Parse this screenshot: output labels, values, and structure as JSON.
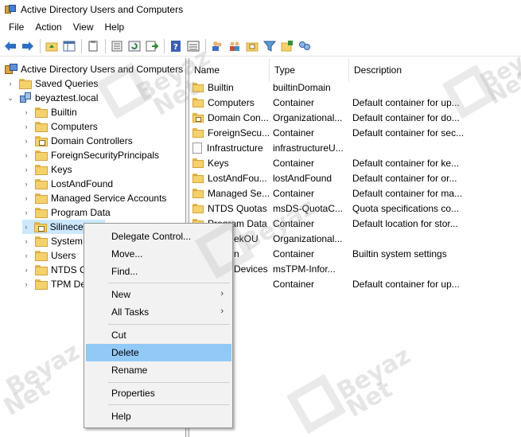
{
  "window": {
    "title": "Active Directory Users and Computers"
  },
  "menu": [
    "File",
    "Action",
    "View",
    "Help"
  ],
  "toolbar": {
    "icons": [
      "back-icon",
      "forward-icon",
      "up-folder-icon",
      "show-console-tree-icon",
      "clipboard-icon",
      "properties-icon",
      "refresh-icon",
      "export-list-icon",
      "help-icon",
      "details-view-icon",
      "users-icon",
      "groups-icon",
      "new-ou-icon",
      "filter-icon",
      "delegate-icon",
      "find-icon"
    ]
  },
  "tree": {
    "root_label": "Active Directory Users and Computers",
    "saved_queries": "Saved Queries",
    "domain": "beyaztest.local",
    "children": [
      "Builtin",
      "Computers",
      "Domain Controllers",
      "ForeignSecurityPrincipals",
      "Keys",
      "LostAndFound",
      "Managed Service Accounts",
      "Program Data",
      "SilinecekOU",
      "System",
      "Users",
      "NTDS Quotas",
      "TPM Devices"
    ],
    "children_visible": [
      "Builtin",
      "Computers",
      "Domain Controllers",
      "ForeignSecurityPrincipals",
      "Keys",
      "LostAndFound",
      "Managed Service Accounts",
      "Program Data",
      "Silinecek OU",
      "System",
      "Users",
      "NTDS C",
      "TPM De"
    ]
  },
  "list": {
    "columns": [
      "Name",
      "Type",
      "Description"
    ],
    "rows": [
      {
        "name": "Builtin",
        "type": "builtinDomain",
        "description": "",
        "icon": "folder"
      },
      {
        "name": "Computers",
        "type": "Container",
        "description": "Default container for up...",
        "icon": "folder"
      },
      {
        "name": "Domain Con...",
        "type": "Organizational...",
        "description": "Default container for do...",
        "icon": "ou"
      },
      {
        "name": "ForeignSecu...",
        "type": "Container",
        "description": "Default container for sec...",
        "icon": "folder"
      },
      {
        "name": "Infrastructure",
        "type": "infrastructureU...",
        "description": "",
        "icon": "doc"
      },
      {
        "name": "Keys",
        "type": "Container",
        "description": "Default container for ke...",
        "icon": "folder"
      },
      {
        "name": "LostAndFou...",
        "type": "lostAndFound",
        "description": "Default container for or...",
        "icon": "folder"
      },
      {
        "name": "Managed Se...",
        "type": "Container",
        "description": "Default container for ma...",
        "icon": "folder"
      },
      {
        "name": "NTDS Quotas",
        "type": "msDS-QuotaC...",
        "description": "Quota specifications co...",
        "icon": "folder"
      },
      {
        "name": "Program Data",
        "type": "Container",
        "description": "Default location for stor...",
        "icon": "folder"
      },
      {
        "name": "ekOU",
        "type": "Organizational...",
        "description": "",
        "icon": "none"
      },
      {
        "name": "n",
        "type": "Container",
        "description": "Builtin system settings",
        "icon": "none"
      },
      {
        "name": "Devices",
        "type": "msTPM-Infor...",
        "description": "",
        "icon": "none"
      },
      {
        "name": "",
        "type": "Container",
        "description": "Default container for up...",
        "icon": "none"
      }
    ]
  },
  "context_menu": {
    "items": [
      {
        "label": "Delegate Control...",
        "submenu": false
      },
      {
        "label": "Move...",
        "submenu": false
      },
      {
        "label": "Find...",
        "submenu": false
      },
      {
        "label": "New",
        "submenu": true
      },
      {
        "label": "All Tasks",
        "submenu": true
      },
      {
        "label": "Cut",
        "submenu": false
      },
      {
        "label": "Delete",
        "submenu": false,
        "highlighted": true
      },
      {
        "label": "Rename",
        "submenu": false
      },
      {
        "label": "Properties",
        "submenu": false
      },
      {
        "label": "Help",
        "submenu": false
      }
    ],
    "arrow_glyph": "›"
  },
  "watermark": {
    "line1": "Beyaz",
    "line2": "Net"
  },
  "colors": {
    "selection": "#cce8ff",
    "menu_highlight": "#91c9f7",
    "folder": "#f4d26b"
  }
}
